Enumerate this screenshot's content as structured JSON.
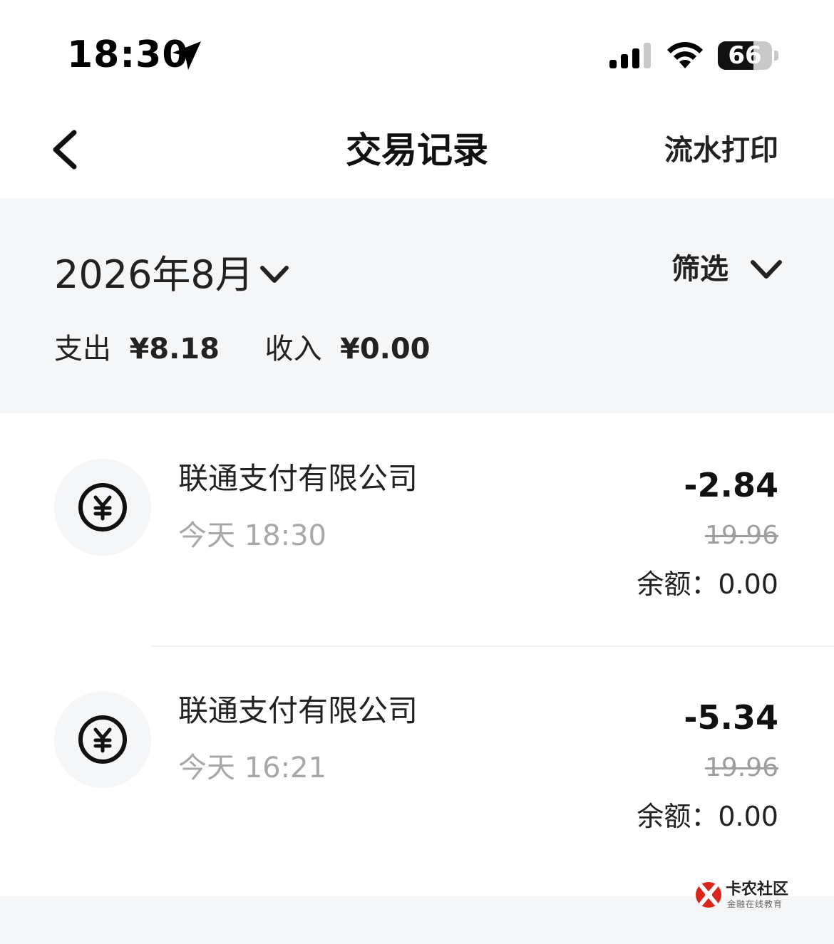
{
  "status_bar": {
    "time": "18:30",
    "battery_percent": "66",
    "battery_level": 0.66
  },
  "nav": {
    "title": "交易记录",
    "print_label": "流水打印"
  },
  "filter_panel": {
    "month": "2026年8月",
    "filter_label": "筛选",
    "expense_label": "支出",
    "expense_value": "¥8.18",
    "income_label": "收入",
    "income_value": "¥0.00"
  },
  "transactions": [
    {
      "merchant": "联通支付有限公司",
      "time": "今天 18:30",
      "amount": "-2.84",
      "original": "19.96",
      "balance": "余额：0.00"
    },
    {
      "merchant": "联通支付有限公司",
      "time": "今天 16:21",
      "amount": "-5.34",
      "original": "19.96",
      "balance": "余额：0.00"
    }
  ],
  "watermark": {
    "name": "卡农社区",
    "sub": "金融在线教育"
  },
  "colors": {
    "panel_bg": "#f5f6f8",
    "text_primary": "#111111",
    "text_muted": "#a8a8a8",
    "watermark_red": "#d9261c"
  }
}
